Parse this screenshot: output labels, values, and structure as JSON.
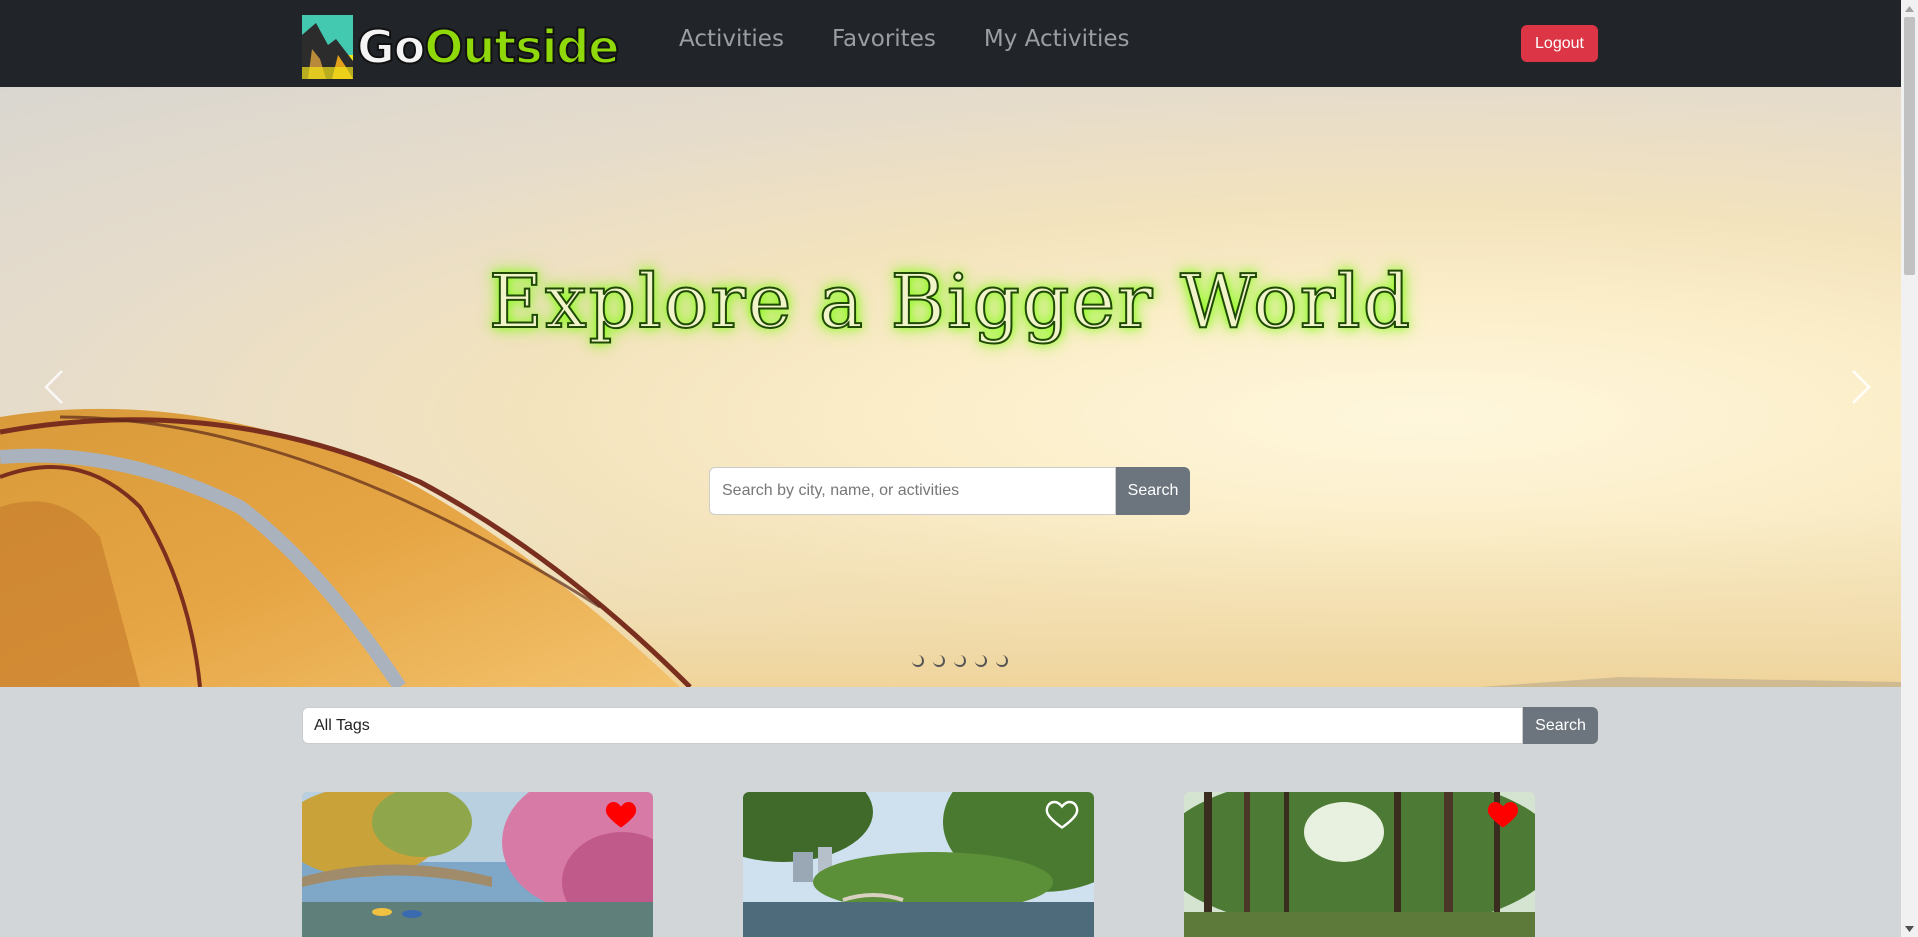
{
  "brand": {
    "go": "Go",
    "outside": "Outside",
    "logo_icon": "landscape-logo-icon"
  },
  "nav": {
    "items": [
      {
        "label": "Activities"
      },
      {
        "label": "Favorites"
      },
      {
        "label": "My Activities"
      }
    ],
    "logout_label": "Logout"
  },
  "hero": {
    "title": "Explore a Bigger World",
    "search_placeholder": "Search by city, name, or activities",
    "search_value": "",
    "search_button": "Search",
    "slide_count": 5,
    "prev_icon": "chevron-left-icon",
    "next_icon": "chevron-right-icon"
  },
  "filter": {
    "selected_tag": "All Tags",
    "button": "Search"
  },
  "cards": [
    {
      "favorited": true,
      "image": "bridge-river-cherry-blossom"
    },
    {
      "favorited": false,
      "image": "city-park-pond"
    },
    {
      "favorited": true,
      "image": "pine-forest-trail"
    }
  ],
  "colors": {
    "navbar": "#212529",
    "logout": "#dc3545",
    "secondary_button": "#6c757d",
    "heart_filled": "#ff0000",
    "title_glow": "#7bff00"
  }
}
